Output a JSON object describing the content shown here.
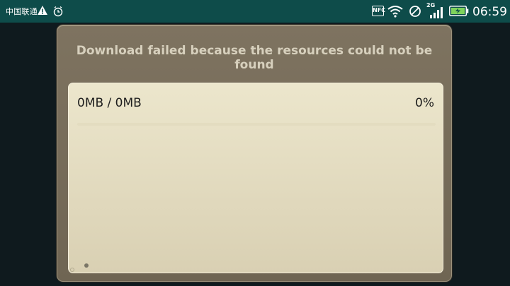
{
  "statusbar": {
    "carrier": "中国联通",
    "nfc_label": "NFC",
    "network_type": "2G",
    "time": "06:59",
    "icons": [
      "warning-icon",
      "alarm-clock-icon",
      "nfc-icon",
      "wifi-icon",
      "do-not-disturb-icon",
      "signal-icon",
      "battery-charging-icon"
    ],
    "colors": {
      "background": "#0e4c4a",
      "foreground": "#ffffff",
      "battery_fill": "#7ed35b"
    }
  },
  "dialog": {
    "title": "Download failed because the resources could not be found",
    "progress_text": "0MB / 0MB",
    "percent_text": "0%",
    "progress_fraction": 0,
    "colors": {
      "frame": "#776c59",
      "title": "#d7d0bd",
      "panel": "#e4dcc0",
      "text": "#1d1d1d"
    }
  }
}
